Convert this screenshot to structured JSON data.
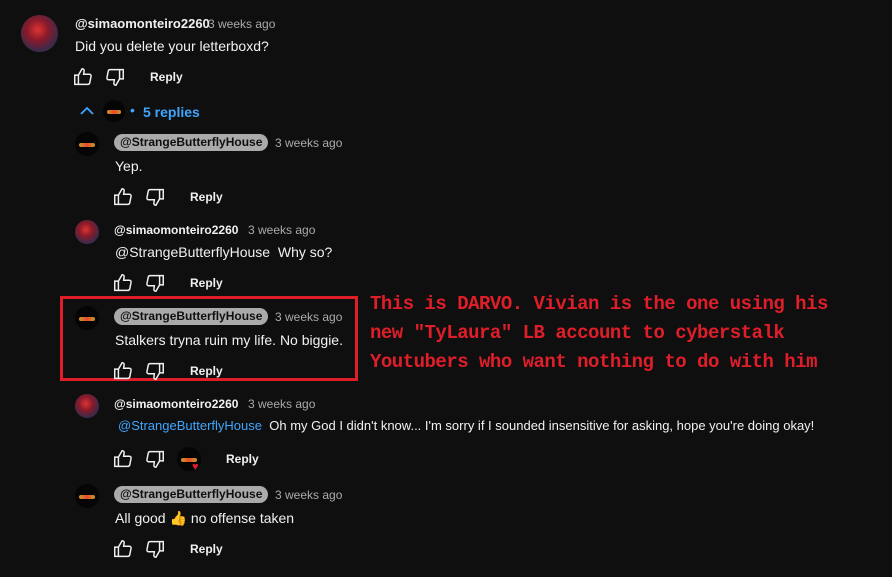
{
  "thread": {
    "top_comment": {
      "author": "@simaomonteiro2260",
      "time": "3 weeks ago",
      "text": "Did you delete your letterboxd?",
      "reply_label": "Reply"
    },
    "replies_toggle": {
      "icon": "chevron-up-icon",
      "label": "5 replies"
    },
    "replies": [
      {
        "author": "@StrangeButterflyHouse",
        "time": "3 weeks ago",
        "text": "Yep.",
        "reply_label": "Reply"
      },
      {
        "author": "@simaomonteiro2260",
        "time": "3 weeks ago",
        "mention": "@StrangeButterflyHouse",
        "text": "Why so?",
        "reply_label": "Reply"
      },
      {
        "author": "@StrangeButterflyHouse",
        "time": "3 weeks ago",
        "text": "Stalkers tryna ruin my life. No biggie.",
        "reply_label": "Reply"
      },
      {
        "author": "@simaomonteiro2260",
        "time": "3 weeks ago",
        "mention": "@StrangeButterflyHouse",
        "text": "Oh my God I didn't know... I'm sorry if I sounded insensitive for asking, hope you're doing okay!",
        "reply_label": "Reply"
      },
      {
        "author": "@StrangeButterflyHouse",
        "time": "3 weeks ago",
        "text": "All good",
        "emoji": "👍",
        "text_after": "no offense taken",
        "reply_label": "Reply"
      }
    ]
  },
  "annotation": {
    "lines": [
      "This is DARVO. Vivian is the one using his",
      "new \"TyLaura\" LB account to cyberstalk",
      "Youtubers who want nothing to do with him"
    ],
    "color": "#e01e2a"
  },
  "colors": {
    "background": "#0f0f0f",
    "text": "#f1f1f1",
    "secondary": "#aaaaaa",
    "link": "#3ea6ff",
    "annotation": "#e01e2a"
  }
}
